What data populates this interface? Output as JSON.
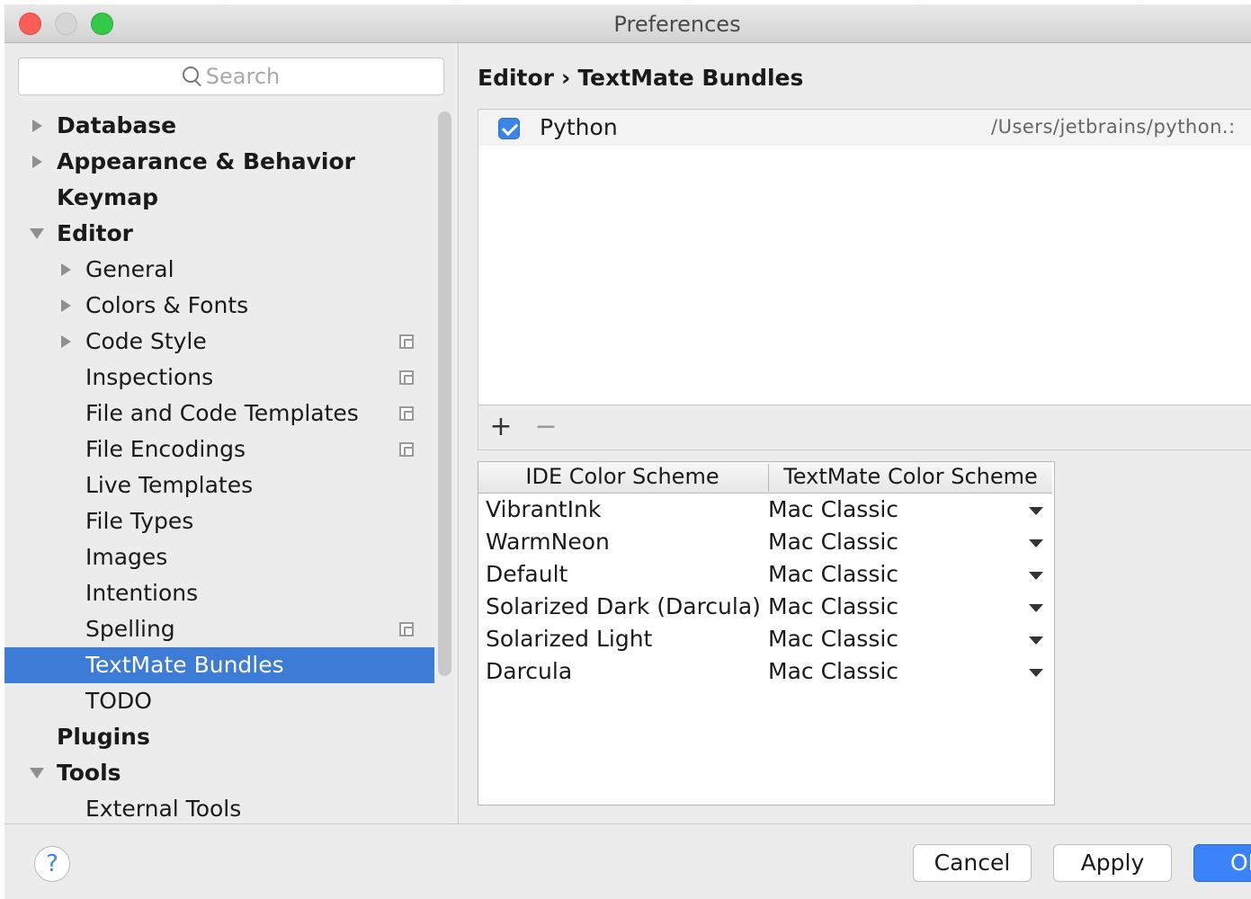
{
  "window": {
    "title": "Preferences"
  },
  "search": {
    "placeholder": "Search"
  },
  "tree": [
    {
      "label": "Database",
      "level": 0,
      "bold": true,
      "arrow": "right",
      "shared": false
    },
    {
      "label": "Appearance & Behavior",
      "level": 0,
      "bold": true,
      "arrow": "right",
      "shared": false
    },
    {
      "label": "Keymap",
      "level": 0,
      "bold": true,
      "arrow": "none",
      "shared": false
    },
    {
      "label": "Editor",
      "level": 0,
      "bold": true,
      "arrow": "down",
      "shared": false
    },
    {
      "label": "General",
      "level": 1,
      "bold": false,
      "arrow": "right",
      "shared": false
    },
    {
      "label": "Colors & Fonts",
      "level": 1,
      "bold": false,
      "arrow": "right",
      "shared": false
    },
    {
      "label": "Code Style",
      "level": 1,
      "bold": false,
      "arrow": "right",
      "shared": true
    },
    {
      "label": "Inspections",
      "level": 1,
      "bold": false,
      "arrow": "none",
      "shared": true
    },
    {
      "label": "File and Code Templates",
      "level": 1,
      "bold": false,
      "arrow": "none",
      "shared": true
    },
    {
      "label": "File Encodings",
      "level": 1,
      "bold": false,
      "arrow": "none",
      "shared": true
    },
    {
      "label": "Live Templates",
      "level": 1,
      "bold": false,
      "arrow": "none",
      "shared": false
    },
    {
      "label": "File Types",
      "level": 1,
      "bold": false,
      "arrow": "none",
      "shared": false
    },
    {
      "label": "Images",
      "level": 1,
      "bold": false,
      "arrow": "none",
      "shared": false
    },
    {
      "label": "Intentions",
      "level": 1,
      "bold": false,
      "arrow": "none",
      "shared": false
    },
    {
      "label": "Spelling",
      "level": 1,
      "bold": false,
      "arrow": "none",
      "shared": true
    },
    {
      "label": "TextMate Bundles",
      "level": 1,
      "bold": false,
      "arrow": "none",
      "shared": false,
      "selected": true
    },
    {
      "label": "TODO",
      "level": 1,
      "bold": false,
      "arrow": "none",
      "shared": false
    },
    {
      "label": "Plugins",
      "level": 0,
      "bold": true,
      "arrow": "none",
      "shared": false
    },
    {
      "label": "Tools",
      "level": 0,
      "bold": true,
      "arrow": "down",
      "shared": false
    },
    {
      "label": "External Tools",
      "level": 1,
      "bold": false,
      "arrow": "none",
      "shared": false
    }
  ],
  "breadcrumb": {
    "parent": "Editor",
    "separator": "›",
    "current": "TextMate Bundles"
  },
  "bundles": [
    {
      "name": "Python",
      "path": "/Users/jetbrains/python.:",
      "checked": true
    }
  ],
  "bundle_toolbar": {
    "add": "+",
    "remove": "−"
  },
  "scheme_table": {
    "headers": [
      "IDE Color Scheme",
      "TextMate Color Scheme"
    ],
    "rows": [
      [
        "VibrantInk",
        "Mac Classic"
      ],
      [
        "WarmNeon",
        "Mac Classic"
      ],
      [
        "Default",
        "Mac Classic"
      ],
      [
        "Solarized Dark (Darcula)",
        "Mac Classic"
      ],
      [
        "Solarized Light",
        "Mac Classic"
      ],
      [
        "Darcula",
        "Mac Classic"
      ]
    ]
  },
  "footer": {
    "help": "?",
    "cancel": "Cancel",
    "apply": "Apply",
    "ok": "OK"
  },
  "colors": {
    "selection": "#3c7bd6",
    "accent": "#3b85e6"
  }
}
